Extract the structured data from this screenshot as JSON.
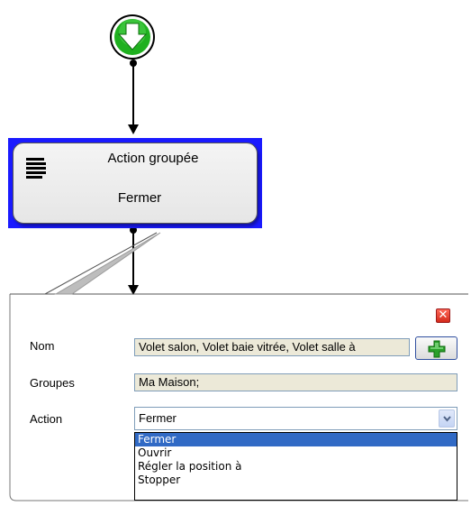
{
  "start_node": {
    "icon": "down-arrow-icon",
    "color": "#1fb01f"
  },
  "action_node": {
    "icon": "group-lines-icon",
    "title": "Action groupée",
    "subtitle": "Fermer",
    "selection_color": "#1a1aff"
  },
  "panel": {
    "close_icon": "close-icon",
    "fields": {
      "name": {
        "label": "Nom",
        "value": "Volet salon, Volet baie vitrée, Volet salle à"
      },
      "groups": {
        "label": "Groupes",
        "value": "Ma Maison;"
      },
      "action": {
        "label": "Action",
        "value": "Fermer"
      }
    },
    "add_icon": "plus-icon",
    "dropdown": {
      "options": [
        "Fermer",
        "Ouvrir",
        "Régler la position à",
        "Stopper"
      ],
      "selected": "Fermer"
    }
  }
}
